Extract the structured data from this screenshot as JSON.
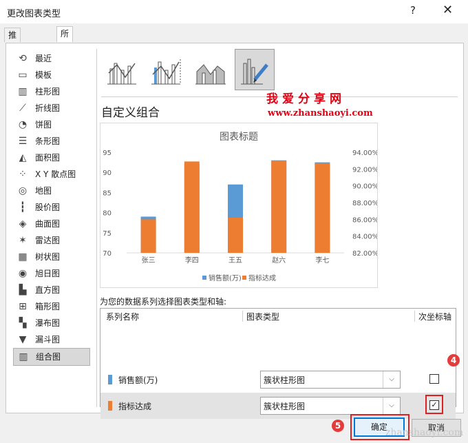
{
  "window": {
    "title": "更改图表类型",
    "help": "?",
    "close": "✕"
  },
  "tabs": [
    {
      "label": "推荐的图表"
    },
    {
      "label": "所有图表"
    }
  ],
  "sidebar": {
    "items": [
      {
        "label": "最近",
        "icon": "recent-icon"
      },
      {
        "label": "模板",
        "icon": "template-icon"
      },
      {
        "label": "柱形图",
        "icon": "column-chart-icon"
      },
      {
        "label": "折线图",
        "icon": "line-chart-icon"
      },
      {
        "label": "饼图",
        "icon": "pie-chart-icon"
      },
      {
        "label": "条形图",
        "icon": "bar-chart-icon"
      },
      {
        "label": "面积图",
        "icon": "area-chart-icon"
      },
      {
        "label": "X Y 散点图",
        "icon": "scatter-chart-icon"
      },
      {
        "label": "地图",
        "icon": "map-chart-icon"
      },
      {
        "label": "股价图",
        "icon": "stock-chart-icon"
      },
      {
        "label": "曲面图",
        "icon": "surface-chart-icon"
      },
      {
        "label": "雷达图",
        "icon": "radar-chart-icon"
      },
      {
        "label": "树状图",
        "icon": "treemap-chart-icon"
      },
      {
        "label": "旭日图",
        "icon": "sunburst-chart-icon"
      },
      {
        "label": "直方图",
        "icon": "histogram-chart-icon"
      },
      {
        "label": "箱形图",
        "icon": "boxplot-chart-icon"
      },
      {
        "label": "瀑布图",
        "icon": "waterfall-chart-icon"
      },
      {
        "label": "漏斗图",
        "icon": "funnel-chart-icon"
      },
      {
        "label": "组合图",
        "icon": "combo-chart-icon",
        "selected": true
      }
    ]
  },
  "main": {
    "combo_title": "自定义组合",
    "watermark": {
      "text": "我爱分享网",
      "url": "www.zhanshaoyi.com"
    },
    "series_prompt": "为您的数据系列选择图表类型和轴:",
    "grid": {
      "headers": {
        "name": "系列名称",
        "type": "图表类型",
        "axis": "次坐标轴"
      },
      "rows": [
        {
          "name": "销售额(万)",
          "color": "#5b9bd5",
          "type": "簇状柱形图",
          "secondary": false
        },
        {
          "name": "指标达成",
          "color": "#ed7d31",
          "type": "簇状柱形图",
          "secondary": true
        }
      ]
    },
    "annotations": {
      "step4": "4",
      "step5": "5"
    }
  },
  "buttons": {
    "ok": "确定",
    "cancel": "取消"
  },
  "footer_watermark": "zhanshaoyi.com",
  "chart_data": {
    "type": "bar",
    "title": "图表标题",
    "categories": [
      "张三",
      "李四",
      "王五",
      "赵六",
      "李七"
    ],
    "series": [
      {
        "name": "销售额(万)",
        "color": "#5b9bd5",
        "axis": "primary",
        "values": [
          79,
          92,
          87,
          93,
          92.5
        ]
      },
      {
        "name": "指标达成",
        "color": "#ed7d31",
        "axis": "secondary",
        "values": [
          0.86,
          0.929,
          0.862,
          0.93,
          0.927
        ]
      }
    ],
    "y_left": {
      "min": 70,
      "max": 95,
      "ticks": [
        "70",
        "75",
        "80",
        "85",
        "90",
        "95"
      ]
    },
    "y_right": {
      "min": 0.82,
      "max": 0.94,
      "ticks": [
        "82.00%",
        "84.00%",
        "86.00%",
        "88.00%",
        "90.00%",
        "92.00%",
        "94.00%"
      ]
    },
    "legend": "bottom",
    "grid": false
  }
}
